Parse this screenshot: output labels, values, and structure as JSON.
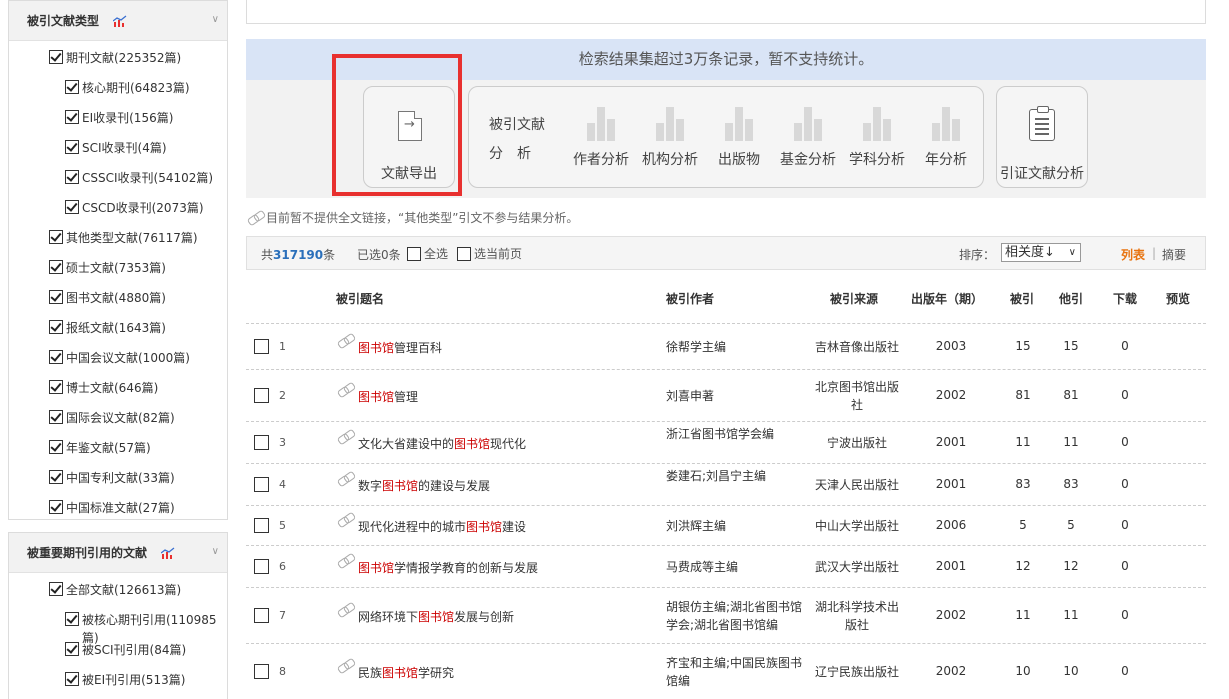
{
  "sidebar": {
    "panel1": {
      "title": "被引文献类型",
      "items": [
        {
          "label": "期刊文献(225352篇)",
          "level": 1,
          "checked": true
        },
        {
          "label": "核心期刊(64823篇)",
          "level": 2,
          "checked": true
        },
        {
          "label": "EI收录刊(156篇)",
          "level": 2,
          "checked": true
        },
        {
          "label": "SCI收录刊(4篇)",
          "level": 2,
          "checked": true
        },
        {
          "label": "CSSCI收录刊(54102篇)",
          "level": 2,
          "checked": true
        },
        {
          "label": "CSCD收录刊(2073篇)",
          "level": 2,
          "checked": true
        },
        {
          "label": "其他类型文献(76117篇)",
          "level": 1,
          "checked": true
        },
        {
          "label": "硕士文献(7353篇)",
          "level": 1,
          "checked": true
        },
        {
          "label": "图书文献(4880篇)",
          "level": 1,
          "checked": true
        },
        {
          "label": "报纸文献(1643篇)",
          "level": 1,
          "checked": true
        },
        {
          "label": "中国会议文献(1000篇)",
          "level": 1,
          "checked": true
        },
        {
          "label": "博士文献(646篇)",
          "level": 1,
          "checked": true
        },
        {
          "label": "国际会议文献(82篇)",
          "level": 1,
          "checked": true
        },
        {
          "label": "年鉴文献(57篇)",
          "level": 1,
          "checked": true
        },
        {
          "label": "中国专利文献(33篇)",
          "level": 1,
          "checked": true
        },
        {
          "label": "中国标准文献(27篇)",
          "level": 1,
          "checked": true
        }
      ]
    },
    "panel2": {
      "title": "被重要期刊引用的文献",
      "items": [
        {
          "label": "全部文献(126613篇)",
          "level": 1,
          "checked": true
        },
        {
          "label": "被核心期刊引用(110985篇)",
          "level": 2,
          "checked": true
        },
        {
          "label": "被SCI刊引用(84篇)",
          "level": 2,
          "checked": true
        },
        {
          "label": "被EI刊引用(513篇)",
          "level": 2,
          "checked": true
        }
      ]
    }
  },
  "notice": "检索结果集超过3万条记录，暂不支持统计。",
  "tools": {
    "export_label": "文献导出",
    "analysis_title_1": "被引文献",
    "analysis_title_2": "分　析",
    "analysis_items": [
      "作者分析",
      "机构分析",
      "出版物",
      "基金分析",
      "学科分析",
      "年分析"
    ],
    "cite_label": "引证文献分析"
  },
  "note": "目前暂不提供全文链接，“其他类型”引文不参与结果分析。",
  "result_bar": {
    "count_prefix": "共",
    "count": "317190",
    "count_suffix": "条",
    "selected": "已选0条",
    "select_all": "全选",
    "select_page": "选当前页",
    "sort_label": "排序：",
    "sort_value": "相关度↓",
    "view_list": "列表",
    "view_sep": "|",
    "view_abstract": "摘要"
  },
  "table": {
    "headers": {
      "title": "被引题名",
      "author": "被引作者",
      "source": "被引来源",
      "year": "出版年（期）",
      "cited": "被引",
      "other": "他引",
      "download": "下载",
      "preview": "预览"
    },
    "rows": [
      {
        "num": "1",
        "pre": "",
        "hl": "图书馆",
        "post": "管理百科",
        "author": "徐帮学主编",
        "source": "吉林音像出版社",
        "year": "2003",
        "cited": "15",
        "other": "15",
        "download": "0"
      },
      {
        "num": "2",
        "pre": "",
        "hl": "图书馆",
        "post": "管理",
        "author": "刘喜申著",
        "source": "北京图书馆出版社",
        "year": "2002",
        "cited": "81",
        "other": "81",
        "download": "0"
      },
      {
        "num": "3",
        "pre": "文化大省建设中的",
        "hl": "图书馆",
        "post": "现代化",
        "author": "浙江省图书馆学会编",
        "source": "宁波出版社",
        "year": "2001",
        "cited": "11",
        "other": "11",
        "download": "0"
      },
      {
        "num": "4",
        "pre": "数字",
        "hl": "图书馆",
        "post": "的建设与发展",
        "author": "娄建石;刘昌宁主编",
        "source": "天津人民出版社",
        "year": "2001",
        "cited": "83",
        "other": "83",
        "download": "0"
      },
      {
        "num": "5",
        "pre": "现代化进程中的城市",
        "hl": "图书馆",
        "post": "建设",
        "author": "刘洪辉主编",
        "source": "中山大学出版社",
        "year": "2006",
        "cited": "5",
        "other": "5",
        "download": "0"
      },
      {
        "num": "6",
        "pre": "",
        "hl": "图书馆",
        "post": "学情报学教育的创新与发展",
        "author": "马费成等主编",
        "source": "武汉大学出版社",
        "year": "2001",
        "cited": "12",
        "other": "12",
        "download": "0"
      },
      {
        "num": "7",
        "pre": "网络环境下",
        "hl": "图书馆",
        "post": "发展与创新",
        "author": "胡银仿主编;湖北省图书馆学会;湖北省图书馆编",
        "source": "湖北科学技术出版社",
        "year": "2002",
        "cited": "11",
        "other": "11",
        "download": "0"
      },
      {
        "num": "8",
        "pre": "民族",
        "hl": "图书馆",
        "post": "学研究",
        "author": "齐宝和主编;中国民族图书馆编",
        "source": "辽宁民族出版社",
        "year": "2002",
        "cited": "10",
        "other": "10",
        "download": "0"
      }
    ]
  }
}
